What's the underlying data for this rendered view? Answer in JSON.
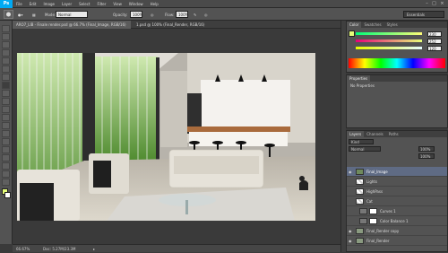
{
  "app": {
    "logo": "Ps"
  },
  "menu": [
    "File",
    "Edit",
    "Image",
    "Layer",
    "Select",
    "Filter",
    "View",
    "Window",
    "Help"
  ],
  "window_controls": [
    "–",
    "□",
    "×"
  ],
  "options": {
    "mode_label": "Mode:",
    "mode_value": "Normal",
    "opacity_label": "Opacity:",
    "opacity_value": "100%",
    "flow_label": "Flow:",
    "flow_value": "100%",
    "workspace": "Essentials"
  },
  "doc_tabs": [
    "ARO7_LIB - Finale render.psd @ 66.7% (Final_Image, RGB/16)",
    "1.psd @ 100% (Final_Render, RGB/16)"
  ],
  "status": {
    "zoom": "66.67%",
    "doc": "Doc: 5.27M/23.3M"
  },
  "color_panel": {
    "tabs": [
      "Color",
      "Swatches",
      "Styles"
    ],
    "active_tab": 0,
    "r": "230",
    "g": "252",
    "b": "120",
    "fg_color": "#e6fc78"
  },
  "properties_panel": {
    "tabs": [
      "Properties"
    ],
    "text": "No Properties"
  },
  "layers_panel": {
    "tabs": [
      "Layers",
      "Channels",
      "Paths"
    ],
    "kind": "Kind",
    "blend": "Normal",
    "opacity": "100%",
    "fill": "100%",
    "layers": [
      {
        "name": "Final_Image",
        "selected": true
      },
      {
        "name": "Lights",
        "selected": false
      },
      {
        "name": "HighPass",
        "selected": false
      },
      {
        "name": "Cat",
        "selected": false
      },
      {
        "name": "Curves 1",
        "selected": false
      },
      {
        "name": "Color Balance 1",
        "selected": false
      },
      {
        "name": "Final_Render copy",
        "selected": false
      },
      {
        "name": "Final_Render",
        "selected": false
      }
    ]
  }
}
